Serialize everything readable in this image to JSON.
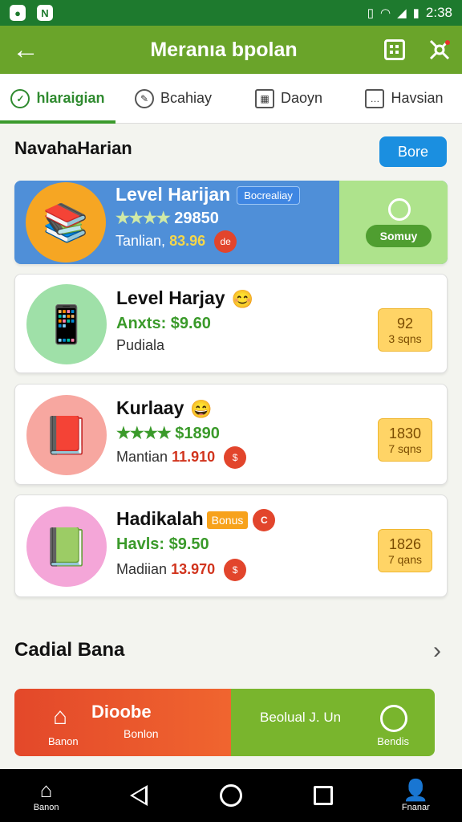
{
  "status_bar": {
    "time": "2:38"
  },
  "app_bar": {
    "title": "Meranıa bpolan"
  },
  "tabs": [
    {
      "label": "hlaraigian",
      "active": true
    },
    {
      "label": "Bcahiay",
      "active": false
    },
    {
      "label": "Daoyn",
      "active": false
    },
    {
      "label": "Havsian",
      "active": false
    }
  ],
  "section": {
    "title": "NavahaHarian",
    "more_label": "Bore"
  },
  "featured": {
    "name": "Level Harijan",
    "badge": "Bocrealiay",
    "stars": "★★★★",
    "rating": "29850",
    "sub_label": "Tanlian,",
    "sub_value": "83.96",
    "coin": "de",
    "action_label": "Somuy"
  },
  "cards": [
    {
      "name": "Level Harjay",
      "rate_prefix": "Anxts:",
      "rate_value": "$9.60",
      "sub_label": "Pudiala",
      "sub_value": "",
      "price": "92",
      "price_sub": "3 sqns"
    },
    {
      "name": "Kurlaay",
      "rate_prefix": "★★★★",
      "rate_value": "$1890",
      "sub_label": "Mantian",
      "sub_value": "11.910",
      "price": "1830",
      "price_sub": "7 sqns"
    },
    {
      "name": "Hadikalah",
      "bonus": "Bonus",
      "rate_prefix": "Havls:",
      "rate_value": "$9.50",
      "sub_label": "Madiian",
      "sub_value": "13.970",
      "price": "1826",
      "price_sub": "7 qans"
    }
  ],
  "section2": {
    "title": "Cadial Bana"
  },
  "banner": {
    "left_icon_label": "Banon",
    "left_title": "Dioobe",
    "left_sub": "Bonlon",
    "right_label": "Beolual J. Un",
    "right_sub": "Bendis"
  },
  "nav": {
    "home_label": "Banon",
    "profile_label": "Fnanar"
  }
}
